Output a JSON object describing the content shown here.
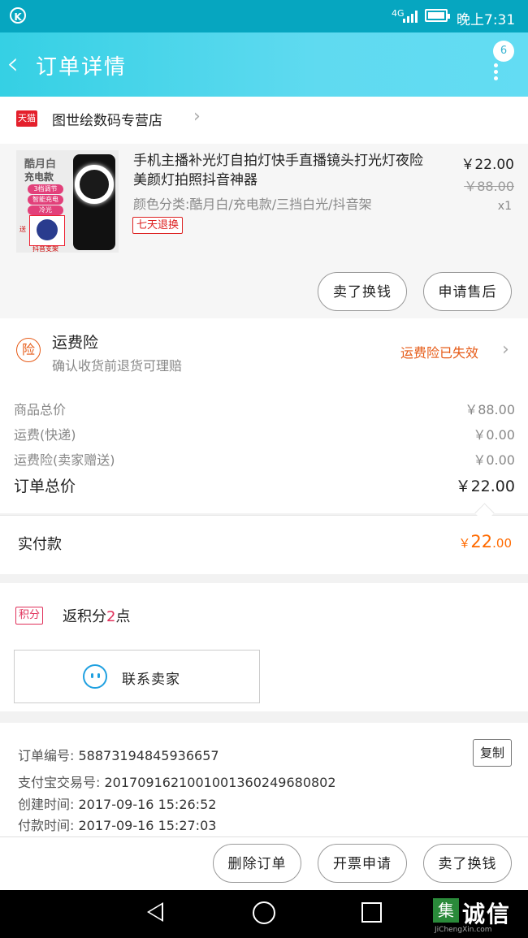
{
  "status_bar": {
    "network": "4G",
    "time": "晚上7:31"
  },
  "header": {
    "title": "订单详情",
    "badge": "6"
  },
  "shop": {
    "platform": "天猫",
    "name": "图世绘数码专营店"
  },
  "product": {
    "thumb": {
      "line1": "酷月白",
      "line2": "充电款",
      "pills": [
        "3档调节",
        "智能充电",
        "冷光"
      ],
      "send": "送",
      "stand": "抖音支架"
    },
    "title": "手机主播补光灯自拍灯快手直播镜头打光灯夜险美颜灯拍照抖音神器",
    "spec": "颜色分类:酷月白/充电款/三挡白光/抖音架",
    "tag": "七天退换",
    "price": "￥22.00",
    "original_price": "￥88.00",
    "quantity": "x1",
    "buttons": {
      "return": "卖了换钱",
      "aftersale": "申请售后"
    }
  },
  "insurance": {
    "icon": "险",
    "title": "运费险",
    "subtitle": "确认收货前退货可理赔",
    "status": "运费险已失效"
  },
  "summary": {
    "rows": [
      {
        "label": "商品总价",
        "value": "￥88.00"
      },
      {
        "label": "运费(快递)",
        "value": "￥0.00"
      },
      {
        "label": "运费险(卖家赠送)",
        "value": "￥0.00"
      }
    ],
    "total_label": "订单总价",
    "total_value": "￥22.00",
    "paid_label": "实付款",
    "paid_currency": "￥",
    "paid_int": "22",
    "paid_dec": ".00"
  },
  "points": {
    "badge": "积分",
    "prefix": "返积分",
    "num": "2",
    "suffix": "点"
  },
  "contact": {
    "label": "联系卖家"
  },
  "info": {
    "copy": "复制",
    "rows": [
      {
        "label": "订单编号:",
        "value": "58873194845936657"
      },
      {
        "label": "支付宝交易号:",
        "value": "2017091621001001360249680802"
      },
      {
        "label": "创建时间:",
        "value": "2017-09-16 15:26:52"
      },
      {
        "label": "付款时间:",
        "value": "2017-09-16 15:27:03"
      }
    ]
  },
  "bottom": {
    "delete": "删除订单",
    "invoice": "开票申请",
    "sell": "卖了换钱"
  },
  "watermark": {
    "logo": "集",
    "text": "诚信",
    "url": "JiChengXin.com"
  },
  "colors": {
    "accent": "#35d0e4",
    "orange": "#ff6a00",
    "red": "#d22",
    "pink": "#e0305a"
  }
}
